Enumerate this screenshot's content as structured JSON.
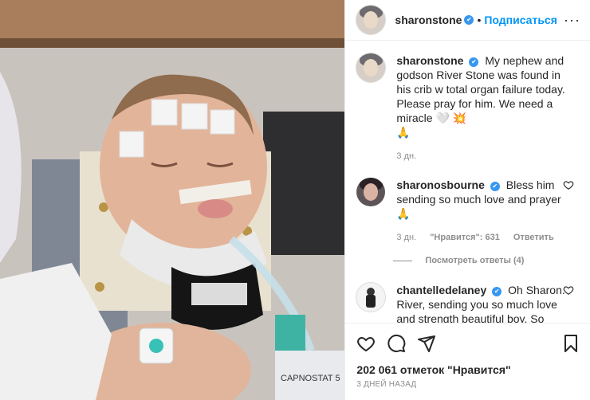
{
  "header": {
    "username": "sharonstone",
    "separator": "•",
    "follow_label": "Подписаться",
    "more_label": "···"
  },
  "caption": {
    "username": "sharonstone",
    "text": "My nephew and godson River Stone was found in his crib w total organ failure today. Please pray for him. We need a miracle",
    "emojis": "🤍 💥",
    "emoji_line2": "🙏",
    "time": "3 дн."
  },
  "comments": [
    {
      "username": "sharonosbourne",
      "text": "Bless him sending so much love and prayer",
      "emoji": "🙏",
      "time": "3 дн.",
      "likes": "\"Нравится\": 631",
      "reply_label": "Ответить",
      "view_replies": "Посмотреть ответы (4)"
    },
    {
      "username": "chantelledelaney",
      "text": "Oh Sharon. River, sending you so much love and strength beautiful boy. So much love to you all",
      "emoji": "❤️"
    }
  ],
  "footer": {
    "likes_text": "202 061 отметок \"Нравится\"",
    "date": "3 ДНЕЙ НАЗАД"
  },
  "photo": {
    "device_label": "CAPNOSTAT 5"
  },
  "icons": [
    "heart-icon",
    "comment-icon",
    "share-icon",
    "bookmark-icon",
    "verified-badge-icon"
  ],
  "colors": {
    "accent": "#0095f6",
    "verified": "#3897f0",
    "muted": "#8e8e8e",
    "emoji_red": "#ed4956"
  }
}
